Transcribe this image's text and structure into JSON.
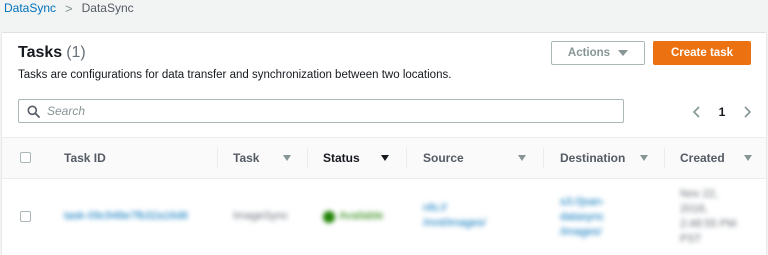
{
  "breadcrumb": {
    "root": "DataSync",
    "current": "DataSync"
  },
  "panel": {
    "title": "Tasks",
    "count": "(1)",
    "description": "Tasks are configurations for data transfer and synchronization between two locations.",
    "actions_label": "Actions",
    "create_label": "Create task"
  },
  "search": {
    "placeholder": "Search"
  },
  "pagination": {
    "page": "1"
  },
  "table": {
    "columns": [
      {
        "label": "Task ID"
      },
      {
        "label": "Task"
      },
      {
        "label": "Status"
      },
      {
        "label": "Source"
      },
      {
        "label": "Destination"
      },
      {
        "label": "Created"
      }
    ],
    "rows": [
      {
        "task_id": "task-09c948e7fb32a16d6",
        "task": "ImageSync",
        "status": "Available",
        "source_line1": "nfs://",
        "source_line2": "/mnt/images/",
        "dest_line1": "s3://jsan-",
        "dest_line2": "datasync",
        "dest_line3": "/images/",
        "created_line1": "Nov 22,",
        "created_line2": "2018,",
        "created_line3": "2:48:55 PM",
        "created_line4": "PST"
      }
    ]
  },
  "colors": {
    "link": "#0073bb",
    "primary": "#ec7211",
    "success": "#1d8102"
  }
}
